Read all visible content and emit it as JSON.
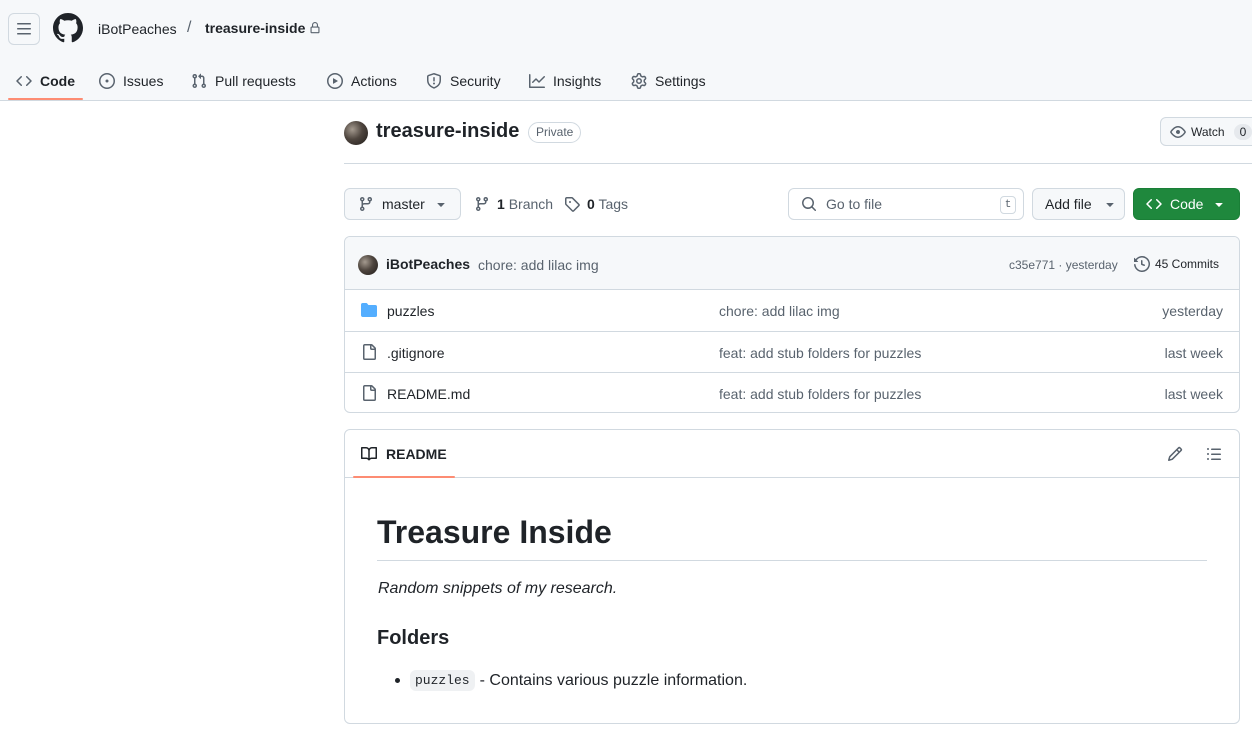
{
  "header": {
    "owner": "iBotPeaches",
    "separator": "/",
    "repo": "treasure-inside"
  },
  "nav": {
    "code": "Code",
    "issues": "Issues",
    "pulls": "Pull requests",
    "actions": "Actions",
    "security": "Security",
    "insights": "Insights",
    "settings": "Settings"
  },
  "repo": {
    "title": "treasure-inside",
    "visibility": "Private",
    "watch_label": "Watch",
    "watch_count": "0"
  },
  "toolbar": {
    "branch": "master",
    "branch_count": "1",
    "branch_label": "Branch",
    "tag_count": "0",
    "tag_label": "Tags",
    "goto_placeholder": "Go to file",
    "goto_shortcut": "t",
    "add_file": "Add file",
    "code": "Code"
  },
  "latest_commit": {
    "author": "iBotPeaches",
    "message": "chore: add lilac img",
    "meta": "c35e771 · yesterday",
    "commits": "45 Commits"
  },
  "files": [
    {
      "name": "puzzles",
      "type": "folder",
      "message": "chore: add lilac img",
      "time": "yesterday"
    },
    {
      "name": ".gitignore",
      "type": "file",
      "message": "feat: add stub folders for puzzles",
      "time": "last week"
    },
    {
      "name": "README.md",
      "type": "file",
      "message": "feat: add stub folders for puzzles",
      "time": "last week"
    }
  ],
  "readme": {
    "tab": "README",
    "h1": "Treasure Inside",
    "tagline": "Random snippets of my research.",
    "h2": "Folders",
    "item_code": "puzzles",
    "item_text": "- Contains various puzzle information."
  },
  "colors": {
    "accent_underline": "#fd8c73",
    "primary_button": "#1f883d",
    "folder_icon": "#54aeff"
  }
}
